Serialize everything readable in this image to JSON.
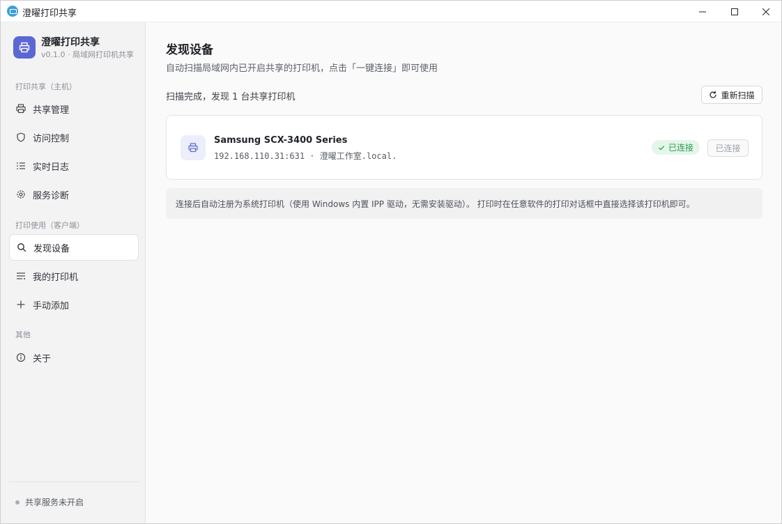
{
  "window": {
    "title": "澄曜打印共享"
  },
  "sidebar": {
    "brand_name": "澄曜打印共享",
    "brand_sub": "v0.1.0 · 局域网打印机共享",
    "sections": [
      {
        "title": "打印共享（主机）",
        "items": [
          {
            "label": "共享管理",
            "icon": "printer-icon"
          },
          {
            "label": "访问控制",
            "icon": "shield-icon"
          },
          {
            "label": "实时日志",
            "icon": "list-icon"
          },
          {
            "label": "服务诊断",
            "icon": "gear-icon"
          }
        ]
      },
      {
        "title": "打印使用（客户端）",
        "items": [
          {
            "label": "发现设备",
            "icon": "search-icon",
            "active": true
          },
          {
            "label": "我的打印机",
            "icon": "list-lines-icon"
          },
          {
            "label": "手动添加",
            "icon": "plus-icon"
          }
        ]
      },
      {
        "title": "其他",
        "items": [
          {
            "label": "关于",
            "icon": "info-icon"
          }
        ]
      }
    ],
    "status_text": "共享服务未开启"
  },
  "main": {
    "title": "发现设备",
    "description": "自动扫描局域网内已开启共享的打印机，点击「一键连接」即可使用",
    "scan_status": "扫描完成，发现 1 台共享打印机",
    "rescan_label": "重新扫描",
    "devices": [
      {
        "name": "Samsung SCX-3400 Series",
        "address": "192.168.110.31:631 · 澄曜工作室.local.",
        "status_badge": "已连接",
        "action_label": "已连接"
      }
    ],
    "note": "连接后自动注册为系统打印机（使用 Windows 内置 IPP 驱动，无需安装驱动）。 打印时在任意软件的打印对话框中直接选择该打印机即可。"
  },
  "colors": {
    "accent": "#5b67d3",
    "success": "#2e9a52",
    "success_bg": "#e4f6ea"
  }
}
